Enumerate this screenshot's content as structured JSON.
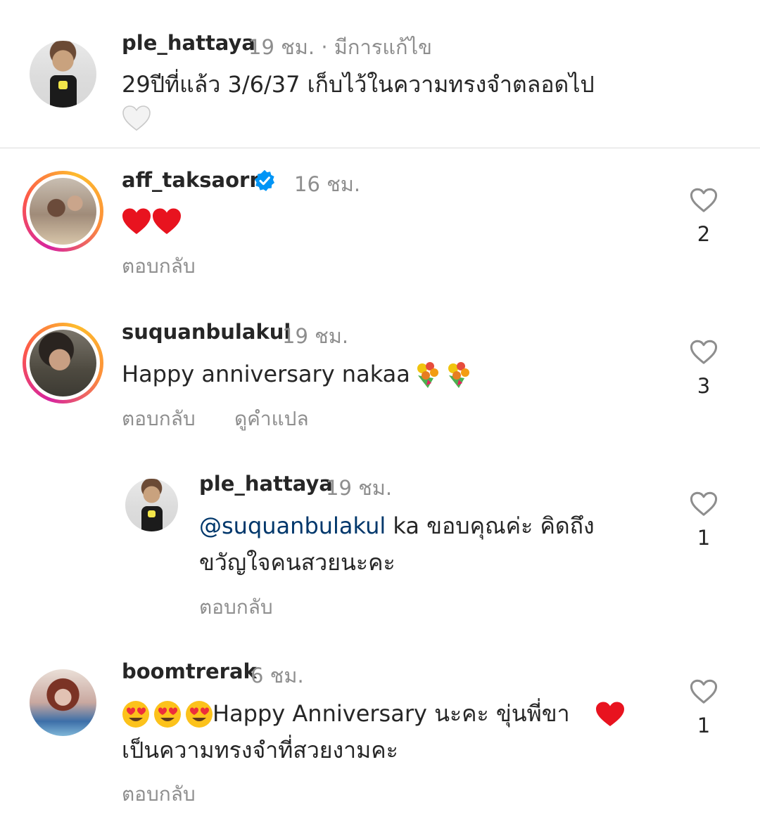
{
  "comments": [
    {
      "username": "ple_hattaya",
      "time": "19 ชม.",
      "edited": " · มีการแก้ไข",
      "text_line1": "29ปีที่แล้ว 3/6/37 เก็บไว้ในความทรงจำตลอดไป",
      "emoji": "white-heart"
    },
    {
      "username": "aff_taksaorn",
      "verified": true,
      "time": "16 ชม.",
      "emoji": "two-red-hearts",
      "reply_label": "ตอบกลับ",
      "like_count": "2"
    },
    {
      "username": "suquanbulakul",
      "time": "19 ชม.",
      "text": "Happy anniversary nakaa",
      "emoji": "bouquet x2",
      "reply_label": "ตอบกลับ",
      "translate_label": "ดูคำแปล",
      "like_count": "3"
    },
    {
      "username": "ple_hattaya",
      "time": "19 ชม.",
      "mention": "@suquanbulakul",
      "text_line1_rest": " ka ขอบคุณค่ะ คิดถึง",
      "text_line2": "ขวัญใจคนสวยนะคะ",
      "reply_label": "ตอบกลับ",
      "like_count": "1"
    },
    {
      "username": "boomtrerak",
      "time": "6 ชม.",
      "text_line1": " Happy Anniversary นะคะ ขุ่นพี่ขา ",
      "text_line2": "เป็นความทรงจำที่สวยงามคะ",
      "emoji_prefix": "heart-eyes x3",
      "emoji_suffix": "red-heart",
      "reply_label": "ตอบกลับ",
      "like_count": "1"
    }
  ],
  "colors": {
    "text": "#262626",
    "secondary": "#8e8e8e",
    "mention": "#00376b",
    "verified": "#0095f6",
    "heart": "#ed1c24",
    "divider": "#dbdbdb"
  }
}
